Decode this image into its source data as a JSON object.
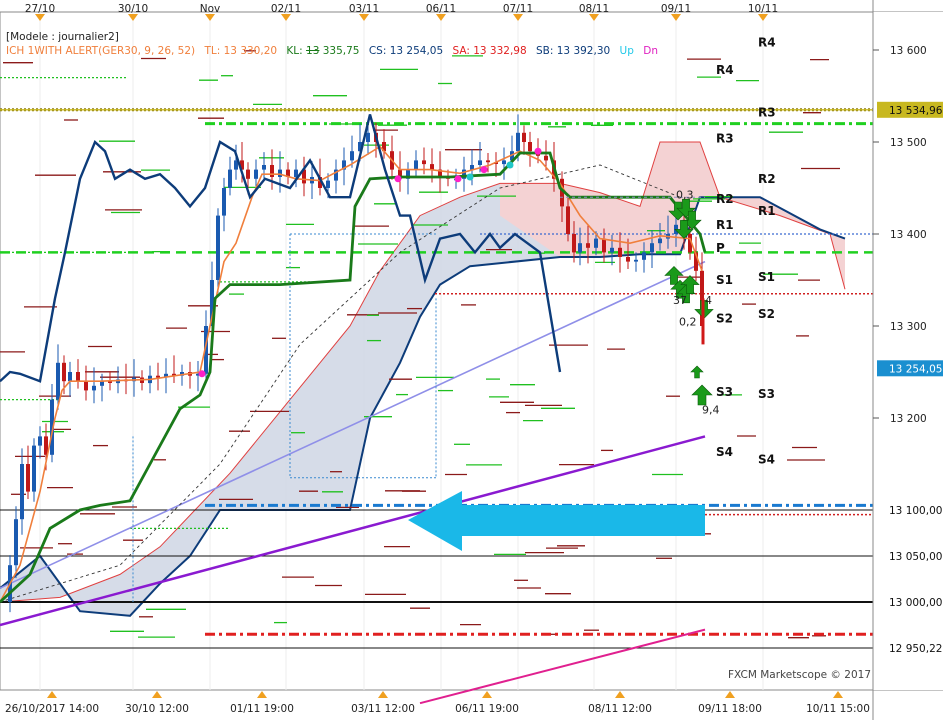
{
  "header": {
    "model": "[Modele : journalier2]",
    "indicator": "ICH 1WITH ALERT(GER30, 9, 26, 52)",
    "tl": "TL: 13 330,20",
    "kl_prefix": "KL: ",
    "kl_strike": "13",
    "kl_rest": " 335,75",
    "cs": "CS: 13 254,05",
    "sa": "SA: 13 332,98",
    "sb": "SB: 13 392,30",
    "up": "Up",
    "dn": "Dn"
  },
  "copyright": "FXCM Marketscope © 2017",
  "colors": {
    "tenkan": "#f07f3c",
    "kijun": "#1a7a1a",
    "chikou": "#0d3c7a",
    "kumo_bull": "#cfd6e4",
    "kumo_bear": "#f7d0d0",
    "sma": "#8f8fe8",
    "purple_trend": "#8a1ad0",
    "magenta_trend": "#e0208f",
    "arrow": "#1ab8e8",
    "support_label_bg": "#1a8fd0"
  },
  "chart_data": {
    "type": "candlestick",
    "symbol": "GER30",
    "top_date_labels": [
      "27/10",
      "30/10",
      "Nov",
      "02/11",
      "03/11",
      "06/11",
      "07/11",
      "08/11",
      "09/11",
      "10/11"
    ],
    "bottom_time_labels": [
      "26/10/2017 14:00",
      "30/10 12:00",
      "01/11 19:00",
      "03/11 12:00",
      "06/11 19:00",
      "08/11 12:00",
      "09/11 18:00",
      "10/11 15:00"
    ],
    "y_axis": {
      "ticks": [
        {
          "value": 13600,
          "label": "13 600"
        },
        {
          "value": 13500,
          "label": "13 500"
        },
        {
          "value": 13400,
          "label": "13 400"
        },
        {
          "value": 13300,
          "label": "13 300"
        },
        {
          "value": 13200,
          "label": "13 200"
        }
      ],
      "ylim": [
        12910,
        13640
      ]
    },
    "price_tags": [
      {
        "value": 13534.96,
        "label": "13 534,96",
        "style": "olive"
      },
      {
        "value": 13254.05,
        "label": "13 254,05",
        "style": "blue"
      },
      {
        "value": 13100,
        "label": "13 100,00",
        "style": "black"
      },
      {
        "value": 13050,
        "label": "13 050,00",
        "style": "black"
      },
      {
        "value": 13000,
        "label": "13 000,00",
        "style": "black"
      },
      {
        "value": 12950,
        "label": "12 950,22",
        "style": "black"
      }
    ],
    "pivot_labels": [
      {
        "label": "R4",
        "value": 13608,
        "col": 1
      },
      {
        "label": "R4",
        "value": 13578,
        "col": 0
      },
      {
        "label": "R3",
        "value": 13532,
        "col": 1
      },
      {
        "label": "R3",
        "value": 13504,
        "col": 0
      },
      {
        "label": "R2",
        "value": 13460,
        "col": 1
      },
      {
        "label": "R2",
        "value": 13438,
        "col": 0
      },
      {
        "label": "R1",
        "value": 13425,
        "col": 1
      },
      {
        "label": "R1",
        "value": 13410,
        "col": 0
      },
      {
        "label": "P",
        "value": 13385,
        "col": 0
      },
      {
        "label": "S1",
        "value": 13353,
        "col": 1
      },
      {
        "label": "S1",
        "value": 13350,
        "col": 0
      },
      {
        "label": "S2",
        "value": 13313,
        "col": 1
      },
      {
        "label": "S2",
        "value": 13308,
        "col": 0
      },
      {
        "label": "S3",
        "value": 13228,
        "col": 0
      },
      {
        "label": "S3",
        "value": 13226,
        "col": 1
      },
      {
        "label": "S4",
        "value": 13163,
        "col": 0
      },
      {
        "label": "S4",
        "value": 13155,
        "col": 1
      }
    ],
    "value_labels": [
      {
        "label": "0,3",
        "value": 13443,
        "x": 676
      },
      {
        "label": "37",
        "value": 13328,
        "x": 673
      },
      {
        "label": "4",
        "value": 13328,
        "x": 705
      },
      {
        "label": "0,2",
        "value": 13305,
        "x": 679
      },
      {
        "label": "9,4",
        "value": 13209,
        "x": 702
      }
    ],
    "horizontal_levels": [
      {
        "value": 13534.96,
        "style": "olive-dotted"
      },
      {
        "value": 13520,
        "style": "green-dashdot"
      },
      {
        "value": 13380,
        "style": "green-dashed"
      },
      {
        "value": 13400,
        "style": "blue-dotted"
      },
      {
        "value": 13335,
        "style": "red-dotted"
      },
      {
        "value": 13105,
        "style": "blue-dashdot"
      },
      {
        "value": 13095,
        "style": "red-dotted"
      },
      {
        "value": 13100,
        "style": "black"
      },
      {
        "value": 13050,
        "style": "black"
      },
      {
        "value": 13000,
        "style": "black-thick"
      },
      {
        "value": 12965,
        "style": "red-dashdot"
      },
      {
        "value": 12950,
        "style": "black"
      }
    ]
  }
}
